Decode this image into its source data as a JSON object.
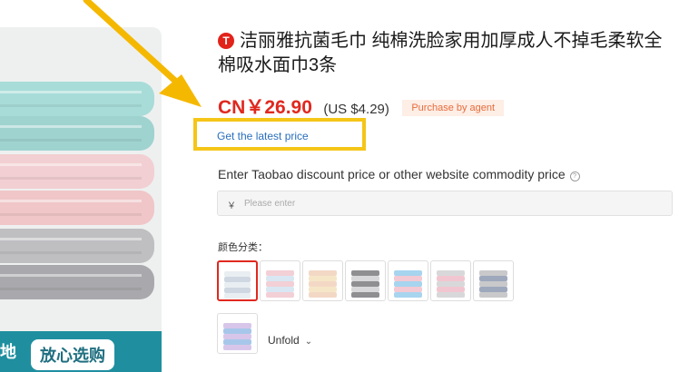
{
  "product": {
    "badge_letter": "T",
    "title": "洁丽雅抗菌毛巾 纯棉洗脸家用加厚成人不掉毛柔软全棉吸水面巾3条",
    "price_cny": "CN￥26.90",
    "price_usd": "(US $4.29)",
    "agent_label": "Purchase by agent",
    "latest_price_link": "Get the latest price"
  },
  "discount": {
    "label": "Enter Taobao discount price or other website commodity price",
    "help": "?",
    "currency_symbol": "￥",
    "placeholder": "Please enter"
  },
  "variants": {
    "label": "颜色分类：",
    "unfold_label": "Unfold",
    "chevron": "⌄",
    "swatches": [
      {
        "colors": [
          "#e9eef2",
          "#cfd7e2"
        ]
      },
      {
        "colors": [
          "#f3cfd6",
          "#d9e7f3"
        ]
      },
      {
        "colors": [
          "#f3d8c6",
          "#f6e6c8"
        ]
      },
      {
        "colors": [
          "#8f8f92",
          "#d8d8da"
        ]
      },
      {
        "colors": [
          "#a7d4ef",
          "#f3c9d3"
        ]
      },
      {
        "colors": [
          "#d8d8da",
          "#f1c6d0"
        ]
      },
      {
        "colors": [
          "#c9c9cb",
          "#9ea8bd"
        ]
      },
      {
        "colors": [
          "#d8c6ea",
          "#a7c7ea"
        ]
      }
    ]
  },
  "image": {
    "tag_text": "放心选购",
    "tag_left_text": "地"
  },
  "colors": {
    "price_red": "#e0281f",
    "highlight_yellow": "#f5c518",
    "link_blue": "#2a6ebd"
  }
}
